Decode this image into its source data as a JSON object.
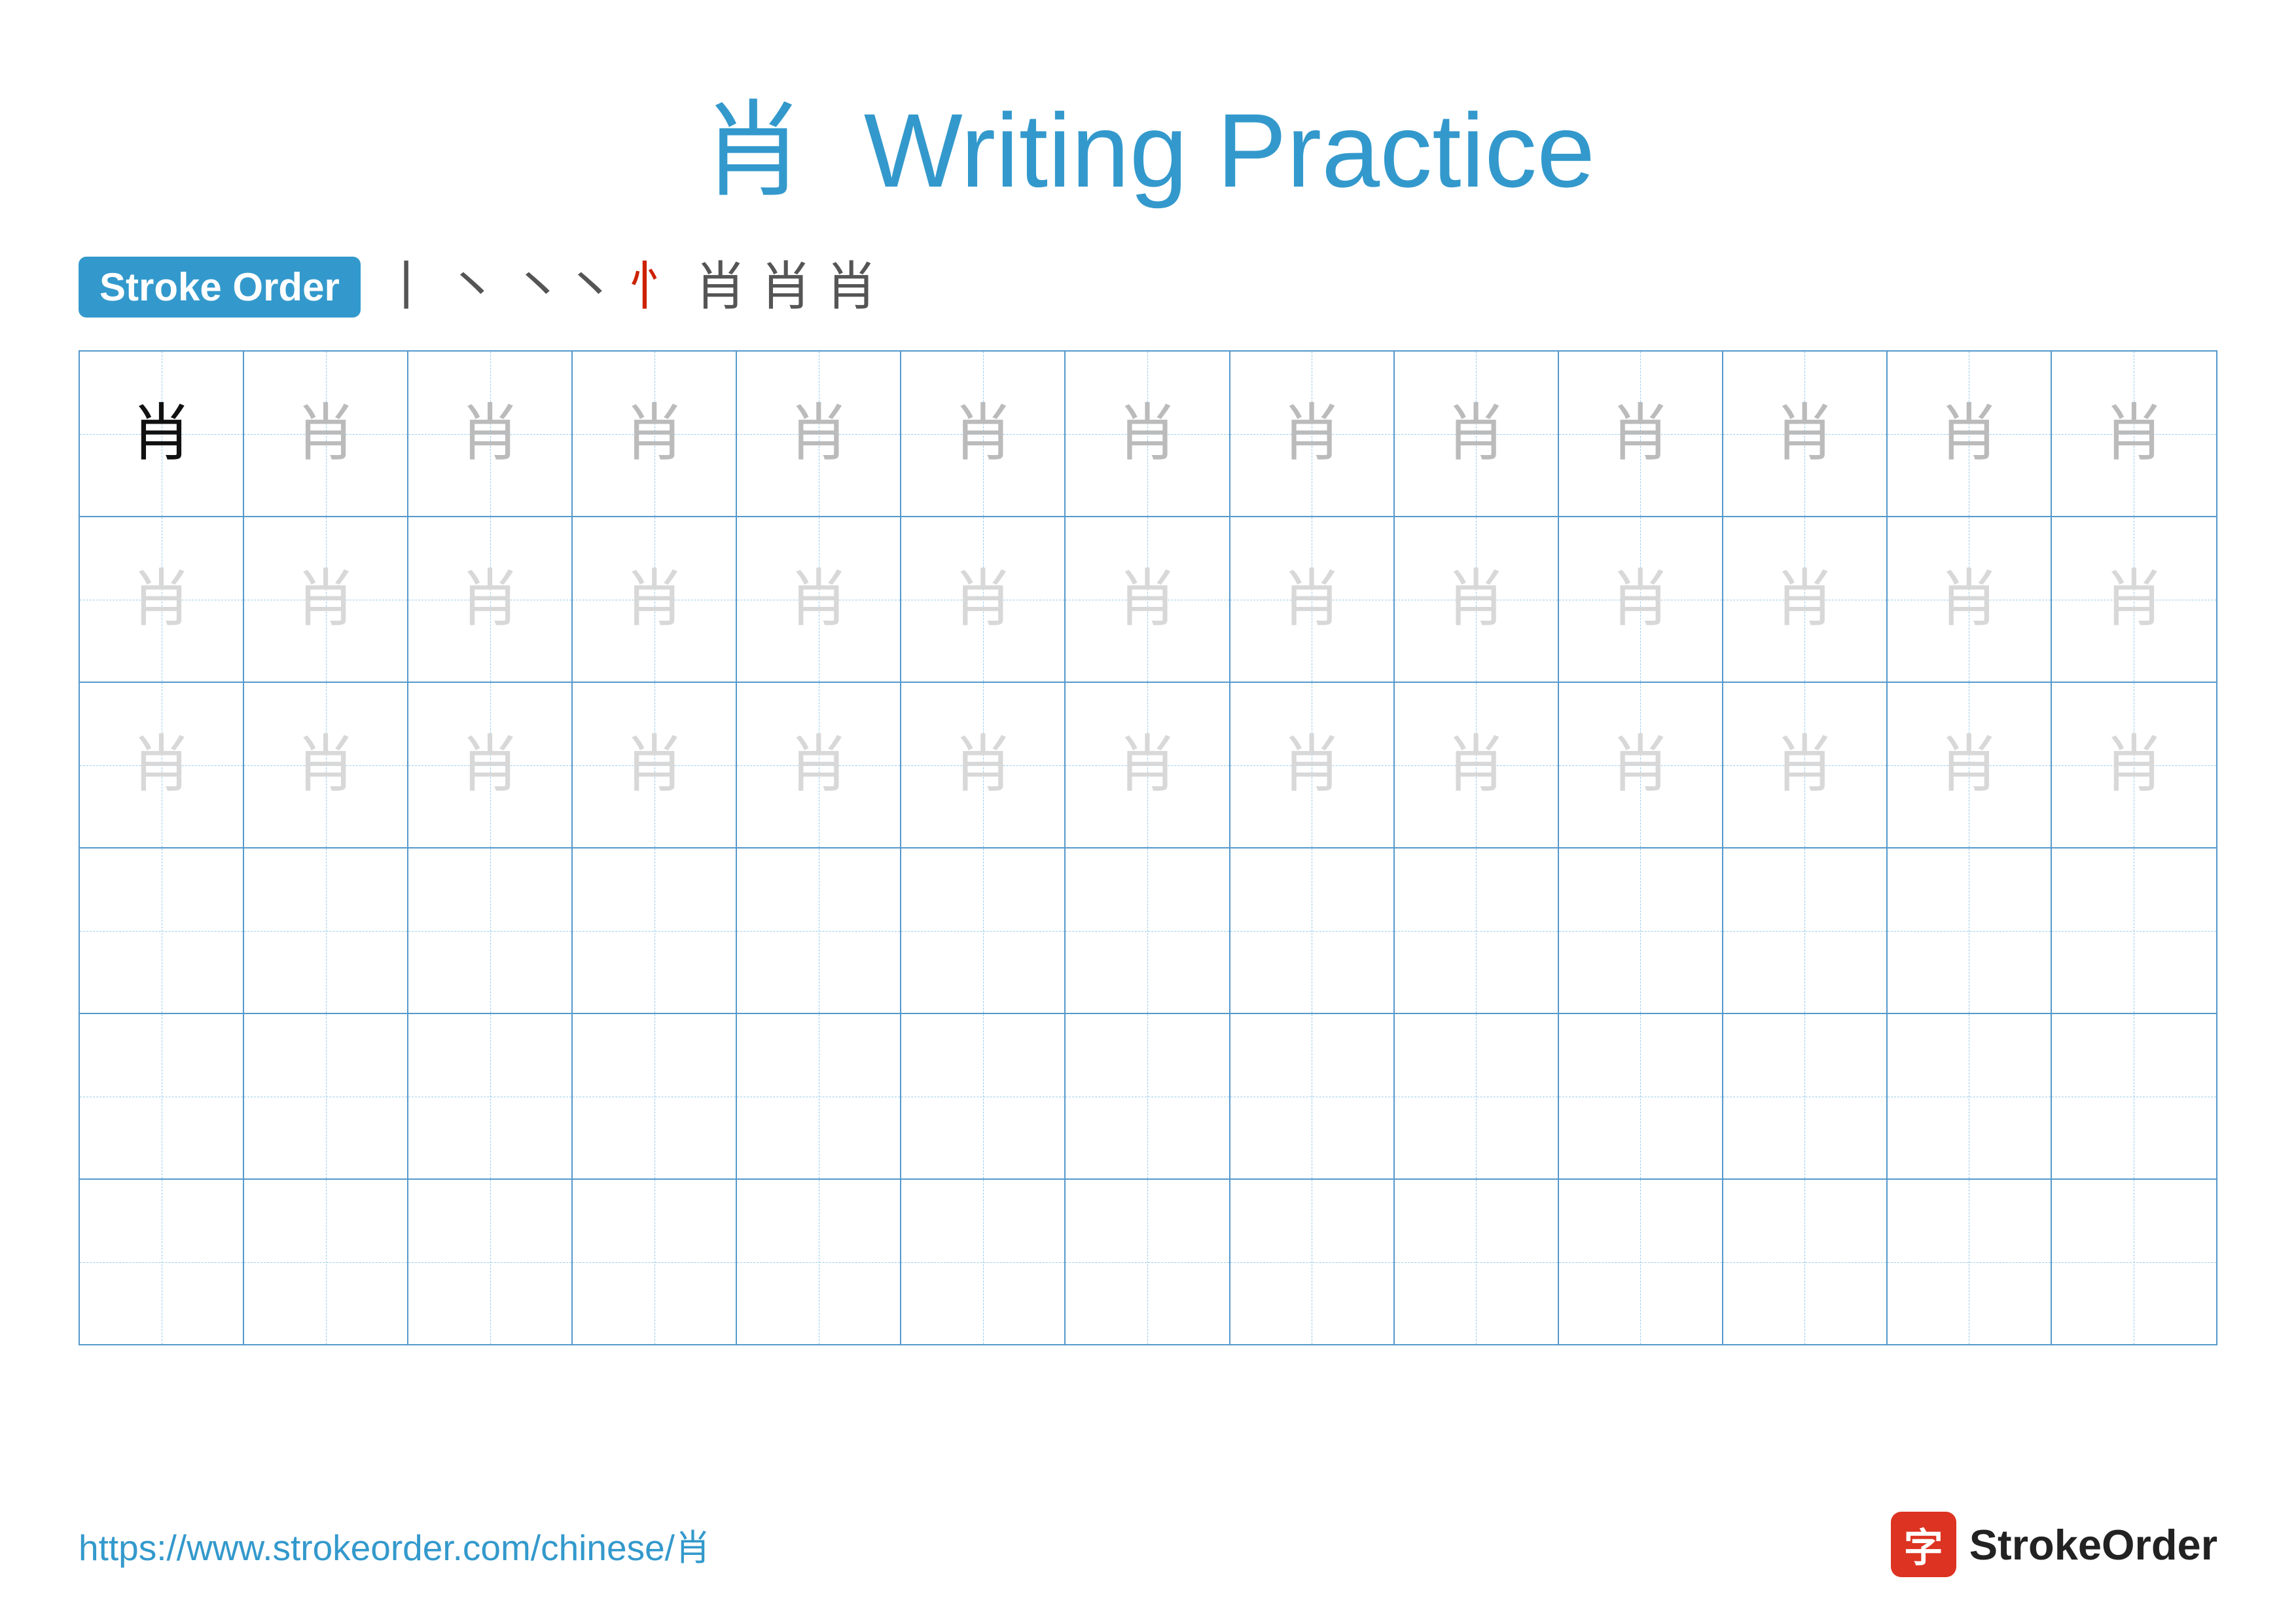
{
  "title": {
    "chinese_char": "肖",
    "label": "Writing Practice",
    "full": "肖 Writing Practice"
  },
  "stroke_order": {
    "badge_label": "Stroke Order",
    "steps": [
      {
        "char": "丨",
        "style": "light"
      },
      {
        "char": "㇀",
        "style": "light"
      },
      {
        "char": "㇀",
        "style": "light"
      },
      {
        "char": "忄",
        "style": "red"
      },
      {
        "char": "肖",
        "style": "light"
      },
      {
        "char": "肖",
        "style": "light"
      },
      {
        "char": "肖",
        "style": "light"
      }
    ]
  },
  "grid": {
    "cols": 13,
    "rows": [
      {
        "type": "dark",
        "cells": [
          "black",
          "medium-gray",
          "medium-gray",
          "medium-gray",
          "medium-gray",
          "medium-gray",
          "medium-gray",
          "medium-gray",
          "medium-gray",
          "medium-gray",
          "medium-gray",
          "medium-gray",
          "medium-gray"
        ]
      },
      {
        "type": "gray",
        "cells": [
          "light-gray",
          "light-gray",
          "light-gray",
          "light-gray",
          "light-gray",
          "light-gray",
          "light-gray",
          "light-gray",
          "light-gray",
          "light-gray",
          "light-gray",
          "light-gray",
          "light-gray"
        ]
      },
      {
        "type": "gray",
        "cells": [
          "light-gray",
          "light-gray",
          "light-gray",
          "light-gray",
          "light-gray",
          "light-gray",
          "light-gray",
          "light-gray",
          "light-gray",
          "light-gray",
          "light-gray",
          "light-gray",
          "light-gray"
        ]
      },
      {
        "type": "empty",
        "cells": [
          "",
          "",
          "",
          "",
          "",
          "",
          "",
          "",
          "",
          "",
          "",
          "",
          ""
        ]
      },
      {
        "type": "empty",
        "cells": [
          "",
          "",
          "",
          "",
          "",
          "",
          "",
          "",
          "",
          "",
          "",
          "",
          ""
        ]
      },
      {
        "type": "empty",
        "cells": [
          "",
          "",
          "",
          "",
          "",
          "",
          "",
          "",
          "",
          "",
          "",
          "",
          ""
        ]
      }
    ]
  },
  "footer": {
    "url": "https://www.strokeorder.com/chinese/肖",
    "logo_char": "字",
    "logo_text": "StrokeOrder"
  }
}
